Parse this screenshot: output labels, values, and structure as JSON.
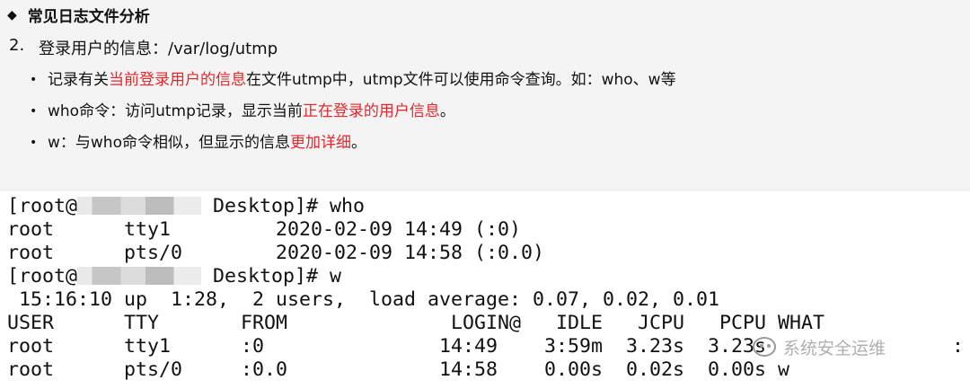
{
  "slide": {
    "heading_icon": "diamond-bullet-icon",
    "heading": "常见日志文件分析",
    "section_number": "2.",
    "section_title": "登录用户的信息：/var/log/utmp",
    "bullets": [
      {
        "pre": "记录有关",
        "red": "当前登录用户的信息",
        "post": "在文件utmp中，utmp文件可以使用命令查询。如：who、w等"
      },
      {
        "pre": "who命令：访问utmp记录，显示当前",
        "red": "正在登录的用户信息",
        "post": "。"
      },
      {
        "pre": "w：与who命令相似，但显示的信息",
        "red": "更加详细",
        "post": "。"
      }
    ],
    "accent_color": "#e8262b"
  },
  "terminal": {
    "prompt1_pre": "[root@",
    "prompt1_post": " Desktop]# who",
    "who_rows": [
      "root      tty1         2020-02-09 14:49 (:0)",
      "root      pts/0        2020-02-09 14:58 (:0.0)"
    ],
    "prompt2_pre": "[root@",
    "prompt2_post": " Desktop]# w",
    "uptime": " 15:16:10 up  1:28,  2 users,  load average: 0.07, 0.02, 0.01",
    "w_header": "USER      TTY       FROM              LOGIN@   IDLE   JCPU   PCPU WHAT",
    "w_rows": [
      "root      tty1      :0               14:49    3:59m  3.23s  3.23s",
      "root      pts/0     :0.0             14:58    0.00s  0.02s  0.00s w"
    ],
    "trailing": ":"
  },
  "watermark": {
    "icon": "wechat-icon",
    "text": "系统安全运维"
  }
}
